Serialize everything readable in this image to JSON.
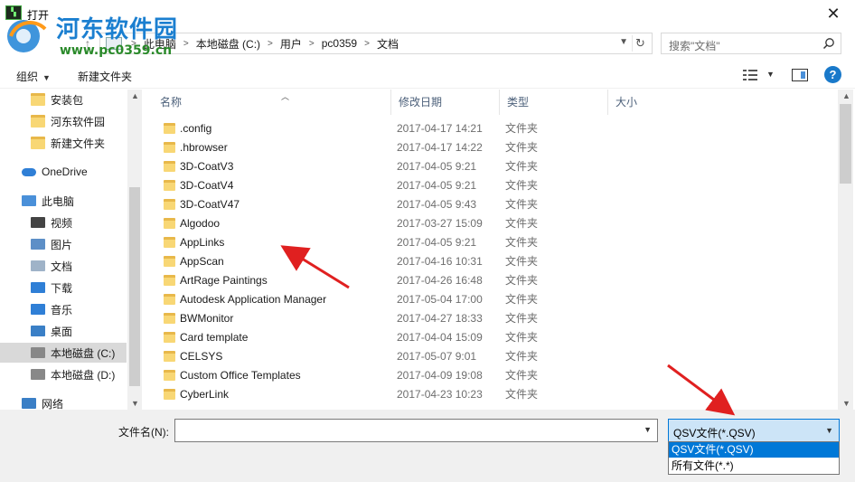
{
  "window": {
    "title": "打开",
    "close": "✕"
  },
  "watermark": {
    "title": "河东软件园",
    "url": "www.pc0359.cn"
  },
  "nav_buttons": {
    "back": "←",
    "forward": "→",
    "up": "↑"
  },
  "address": {
    "crumbs": [
      "此电脑",
      "本地磁盘 (C:)",
      "用户",
      "pc0359",
      "文档"
    ],
    "separator": ">",
    "refresh": "↻"
  },
  "search": {
    "placeholder": "搜索\"文档\""
  },
  "toolbar": {
    "organize": "组织",
    "new_folder": "新建文件夹",
    "help": "?"
  },
  "sidebar": {
    "items": [
      {
        "label": "安装包",
        "icon": "folder-icon"
      },
      {
        "label": "河东软件园",
        "icon": "folder-icon"
      },
      {
        "label": "新建文件夹",
        "icon": "folder-icon"
      },
      {
        "label": "OneDrive",
        "icon": "cloud-icon"
      },
      {
        "label": "此电脑",
        "icon": "computer-icon"
      },
      {
        "label": "视频",
        "icon": "video-icon"
      },
      {
        "label": "图片",
        "icon": "pictures-icon"
      },
      {
        "label": "文档",
        "icon": "documents-icon"
      },
      {
        "label": "下载",
        "icon": "download-icon"
      },
      {
        "label": "音乐",
        "icon": "music-icon"
      },
      {
        "label": "桌面",
        "icon": "desktop-icon"
      },
      {
        "label": "本地磁盘 (C:)",
        "icon": "drive-icon"
      },
      {
        "label": "本地磁盘 (D:)",
        "icon": "drive-icon"
      },
      {
        "label": "网络",
        "icon": "network-icon"
      }
    ]
  },
  "columns": {
    "name": "名称",
    "date": "修改日期",
    "type": "类型",
    "size": "大小"
  },
  "files": [
    {
      "name": ".config",
      "date": "2017-04-17 14:21",
      "type": "文件夹"
    },
    {
      "name": ".hbrowser",
      "date": "2017-04-17 14:22",
      "type": "文件夹"
    },
    {
      "name": "3D-CoatV3",
      "date": "2017-04-05 9:21",
      "type": "文件夹"
    },
    {
      "name": "3D-CoatV4",
      "date": "2017-04-05 9:21",
      "type": "文件夹"
    },
    {
      "name": "3D-CoatV47",
      "date": "2017-04-05 9:43",
      "type": "文件夹"
    },
    {
      "name": "Algodoo",
      "date": "2017-03-27 15:09",
      "type": "文件夹"
    },
    {
      "name": "AppLinks",
      "date": "2017-04-05 9:21",
      "type": "文件夹"
    },
    {
      "name": "AppScan",
      "date": "2017-04-16 10:31",
      "type": "文件夹"
    },
    {
      "name": "ArtRage Paintings",
      "date": "2017-04-26 16:48",
      "type": "文件夹"
    },
    {
      "name": "Autodesk Application Manager",
      "date": "2017-05-04 17:00",
      "type": "文件夹"
    },
    {
      "name": "BWMonitor",
      "date": "2017-04-27 18:33",
      "type": "文件夹"
    },
    {
      "name": "Card template",
      "date": "2017-04-04 15:09",
      "type": "文件夹"
    },
    {
      "name": "CELSYS",
      "date": "2017-05-07 9:01",
      "type": "文件夹"
    },
    {
      "name": "Custom Office Templates",
      "date": "2017-04-09 19:08",
      "type": "文件夹"
    },
    {
      "name": "CyberLink",
      "date": "2017-04-23 10:23",
      "type": "文件夹"
    }
  ],
  "filename": {
    "label": "文件名(N):",
    "value": ""
  },
  "filetype": {
    "selected": "QSV文件(*.QSV)",
    "options": [
      "QSV文件(*.QSV)",
      "所有文件(*.*)"
    ]
  },
  "colors": {
    "accent": "#0078d7",
    "folder": "#f8d775",
    "arrow": "#e02020",
    "watermark_blue": "#1b7fd0"
  }
}
